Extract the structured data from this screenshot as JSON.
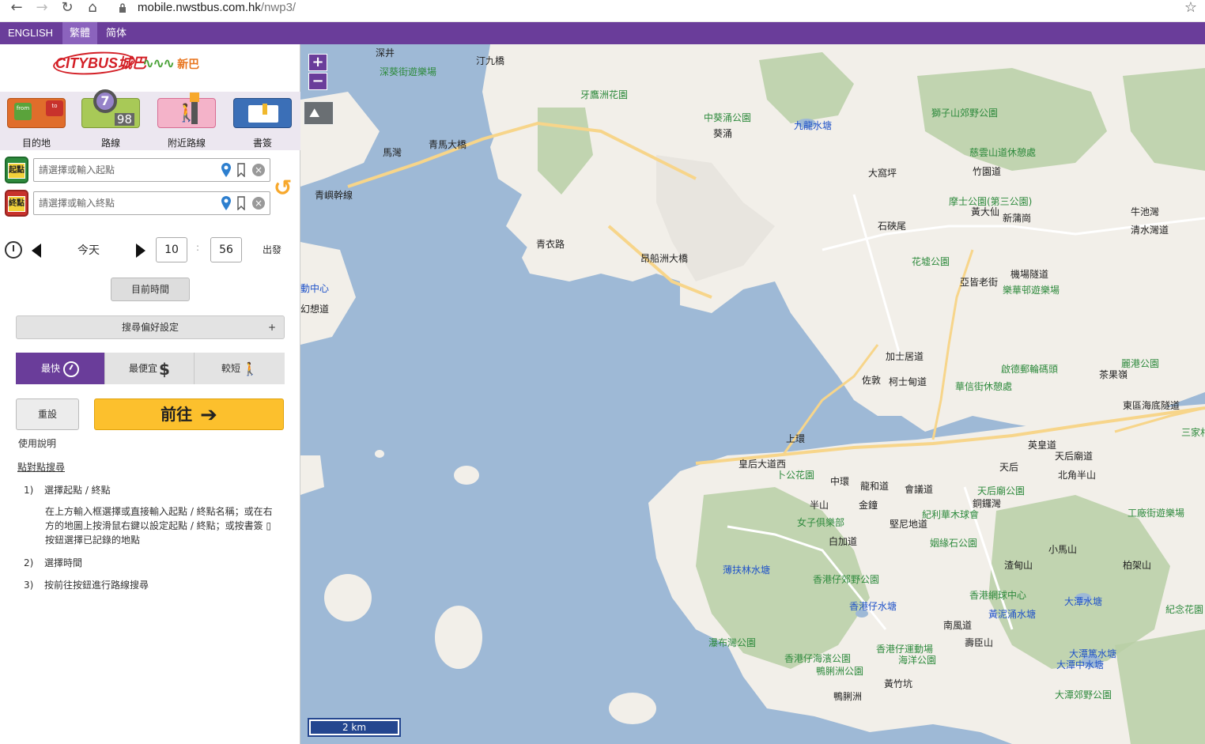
{
  "browser": {
    "url_host": "mobile.nwstbus.com.hk",
    "url_path": "/nwp3/"
  },
  "languages": [
    "ENGLISH",
    "繁體",
    "简体"
  ],
  "active_language": "繁體",
  "logos": {
    "citybus": "CITYBUS城巴",
    "firstbus": "新巴"
  },
  "nav_icons": [
    {
      "label": "目的地"
    },
    {
      "label": "路線",
      "badge_circle": "7",
      "badge_num": "98"
    },
    {
      "label": "附近路線"
    },
    {
      "label": "書簽"
    }
  ],
  "origin": {
    "badge": "起點",
    "placeholder": "請選擇或輸入起點"
  },
  "destination": {
    "badge": "終點",
    "placeholder": "請選擇或輸入終點"
  },
  "time": {
    "day": "今天",
    "hour": "10",
    "minute": "56",
    "separator": ":",
    "mode": "出發"
  },
  "buttons": {
    "now": "目前時間",
    "preferences": "搜尋偏好設定",
    "preferences_toggle": "+",
    "reset": "重設",
    "go": "前往",
    "go_arrow": "➔"
  },
  "sort_options": [
    {
      "label": "最快",
      "icon": "clock-icon",
      "active": true
    },
    {
      "label": "最便宜",
      "icon": "dollar-icon",
      "glyph": "$",
      "active": false
    },
    {
      "label": "較短",
      "icon": "walking-icon",
      "glyph": "🚶",
      "active": false
    }
  ],
  "help": {
    "link": "使用說明",
    "heading": "點對點搜尋",
    "steps": [
      {
        "num": "1)",
        "text": "選擇起點 / 終點"
      },
      {
        "num": "2)",
        "text": "選擇時間"
      },
      {
        "num": "3)",
        "text": "按前往按鈕進行路線搜尋"
      }
    ],
    "step1_desc": "在上方輸入框選擇或直接輸入起點 / 終點名稱；或在右方的地圖上按滑鼠右鍵以設定起點 / 終點；或按書簽 ▯ 按鈕選擇已記錄的地點"
  },
  "map": {
    "zoom_in": "+",
    "zoom_out": "−",
    "scale": "2 km",
    "water_color": "#9eb9d6",
    "land_color": "#f2efe9",
    "hill_color": "#b9cfa6",
    "labels": [
      {
        "text": "深井",
        "kind": "place"
      },
      {
        "text": "深葵街遊樂場",
        "kind": "park"
      },
      {
        "text": "汀九橋",
        "kind": "road"
      },
      {
        "text": "青馬大橋",
        "kind": "road"
      },
      {
        "text": "馬灣",
        "kind": "place"
      },
      {
        "text": "青嶼幹線",
        "kind": "road"
      },
      {
        "text": "牙鷹洲花園",
        "kind": "park"
      },
      {
        "text": "青衣路",
        "kind": "road"
      },
      {
        "text": "昂船洲大橋",
        "kind": "road"
      },
      {
        "text": "中葵涌公園",
        "kind": "park"
      },
      {
        "text": "葵涌",
        "kind": "place"
      },
      {
        "text": "九龍水塘",
        "kind": "water"
      },
      {
        "text": "獅子山郊野公園",
        "kind": "park"
      },
      {
        "text": "大窩坪",
        "kind": "place"
      },
      {
        "text": "慈雲山道休憩處",
        "kind": "park"
      },
      {
        "text": "竹園道",
        "kind": "road"
      },
      {
        "text": "摩士公園(第三公園)",
        "kind": "park"
      },
      {
        "text": "牛池灣",
        "kind": "place"
      },
      {
        "text": "清水灣道",
        "kind": "road"
      },
      {
        "text": "黃大仙",
        "kind": "place"
      },
      {
        "text": "新蒲崗",
        "kind": "place"
      },
      {
        "text": "石硤尾",
        "kind": "place"
      },
      {
        "text": "花墟公園",
        "kind": "park"
      },
      {
        "text": "亞皆老街",
        "kind": "road"
      },
      {
        "text": "機場隧道",
        "kind": "road"
      },
      {
        "text": "樂華邨遊樂場",
        "kind": "park"
      },
      {
        "text": "啟德郵輪碼頭",
        "kind": "park"
      },
      {
        "text": "麗港公園",
        "kind": "park"
      },
      {
        "text": "茶果嶺",
        "kind": "place"
      },
      {
        "text": "佐敦",
        "kind": "place"
      },
      {
        "text": "柯士甸道",
        "kind": "road"
      },
      {
        "text": "加士居道",
        "kind": "road"
      },
      {
        "text": "華信街休憩處",
        "kind": "park"
      },
      {
        "text": "東區海底隧道",
        "kind": "road"
      },
      {
        "text": "三家村",
        "kind": "park"
      },
      {
        "text": "上環",
        "kind": "place"
      },
      {
        "text": "皇后大道西",
        "kind": "road"
      },
      {
        "text": "卜公花園",
        "kind": "park"
      },
      {
        "text": "中環",
        "kind": "place"
      },
      {
        "text": "龍和道",
        "kind": "road"
      },
      {
        "text": "會議道",
        "kind": "road"
      },
      {
        "text": "天后",
        "kind": "place"
      },
      {
        "text": "天后廟公園",
        "kind": "park"
      },
      {
        "text": "北角半山",
        "kind": "place"
      },
      {
        "text": "英皇道",
        "kind": "road"
      },
      {
        "text": "天后廟道",
        "kind": "road"
      },
      {
        "text": "工廠街遊樂場",
        "kind": "park"
      },
      {
        "text": "半山",
        "kind": "place"
      },
      {
        "text": "金鐘",
        "kind": "place"
      },
      {
        "text": "堅尼地道",
        "kind": "road"
      },
      {
        "text": "女子俱樂部",
        "kind": "park"
      },
      {
        "text": "紀利華木球會",
        "kind": "park"
      },
      {
        "text": "銅鑼灣",
        "kind": "place"
      },
      {
        "text": "白加道",
        "kind": "road"
      },
      {
        "text": "姻緣石公園",
        "kind": "park"
      },
      {
        "text": "小馬山",
        "kind": "place"
      },
      {
        "text": "柏架山",
        "kind": "place"
      },
      {
        "text": "渣甸山",
        "kind": "place"
      },
      {
        "text": "薄扶林水塘",
        "kind": "water"
      },
      {
        "text": "香港仔郊野公園",
        "kind": "park"
      },
      {
        "text": "香港網球中心",
        "kind": "park"
      },
      {
        "text": "大潭水塘",
        "kind": "water"
      },
      {
        "text": "香港仔水塘",
        "kind": "water"
      },
      {
        "text": "黃泥涌水塘",
        "kind": "water"
      },
      {
        "text": "紀念花園",
        "kind": "park"
      },
      {
        "text": "南風道",
        "kind": "road"
      },
      {
        "text": "瀑布灣公園",
        "kind": "park"
      },
      {
        "text": "香港仔運動場",
        "kind": "park"
      },
      {
        "text": "海洋公園",
        "kind": "park"
      },
      {
        "text": "壽臣山",
        "kind": "place"
      },
      {
        "text": "大潭篤水塘",
        "kind": "water"
      },
      {
        "text": "大潭中水塘",
        "kind": "water"
      },
      {
        "text": "香港仔海濱公園",
        "kind": "park"
      },
      {
        "text": "鴨脷洲公園",
        "kind": "park"
      },
      {
        "text": "黃竹坑",
        "kind": "place"
      },
      {
        "text": "鴨脷洲",
        "kind": "place"
      },
      {
        "text": "大潭郊野公園",
        "kind": "park"
      },
      {
        "text": "動中心",
        "kind": "water"
      },
      {
        "text": "幻想道",
        "kind": "place"
      }
    ]
  }
}
